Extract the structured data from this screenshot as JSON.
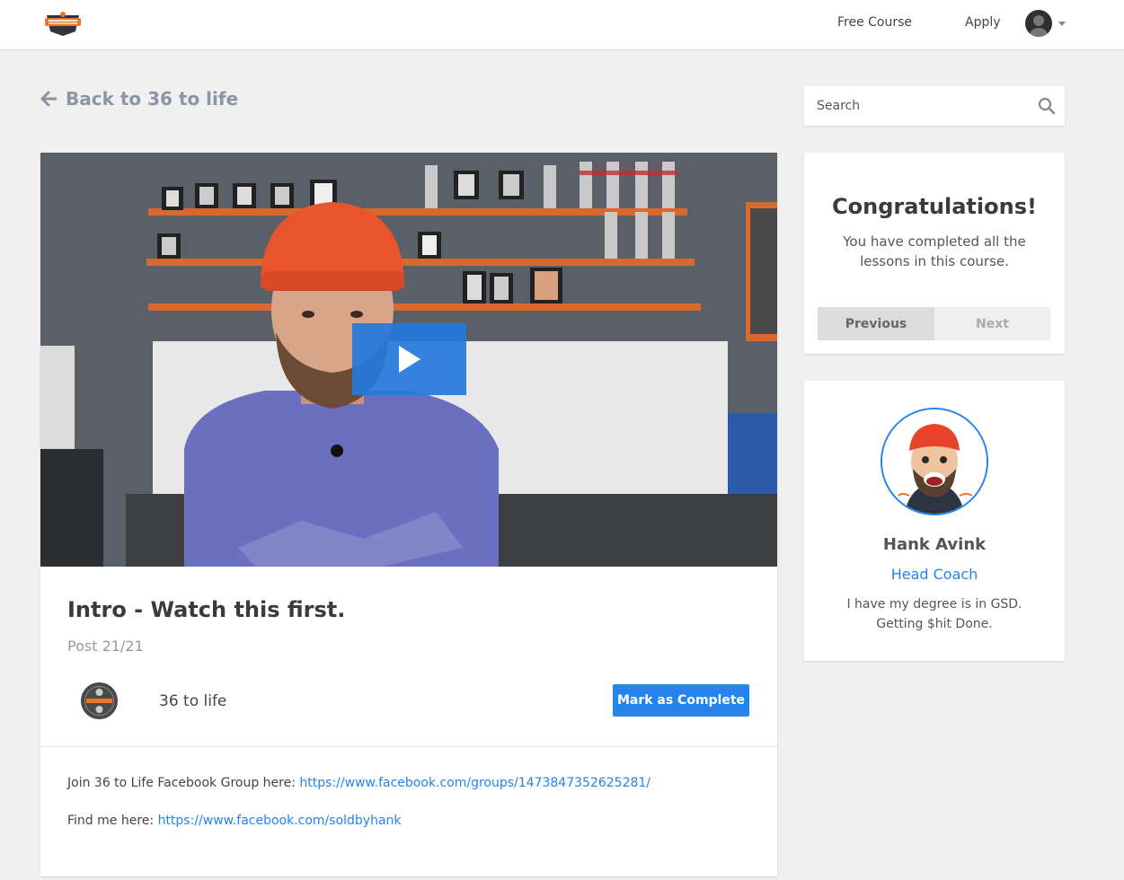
{
  "nav": {
    "free_course": "Free Course",
    "apply": "Apply"
  },
  "back_link": "Back to 36 to life",
  "lesson": {
    "title": "Intro - Watch this first.",
    "post_count": "Post 21/21",
    "course_name": "36 to life",
    "mark_complete": "Mark as Complete",
    "description_1_prefix": "Join 36 to Life Facebook Group here: ",
    "description_1_link": "https://www.facebook.com/groups/1473847352625281/",
    "description_2_prefix": "Find me here: ",
    "description_2_link": "https://www.facebook.com/soldbyhank"
  },
  "search": {
    "placeholder": "Search"
  },
  "congrats": {
    "title": "Congratulations!",
    "text": "You have completed all the lessons in this course.",
    "previous": "Previous",
    "next": "Next"
  },
  "coach": {
    "name": "Hank Avink",
    "role": "Head Coach",
    "bio": "I have my degree is in GSD. Getting $hit Done."
  },
  "colors": {
    "accent": "#2385ec",
    "background": "#f0f0f0"
  }
}
